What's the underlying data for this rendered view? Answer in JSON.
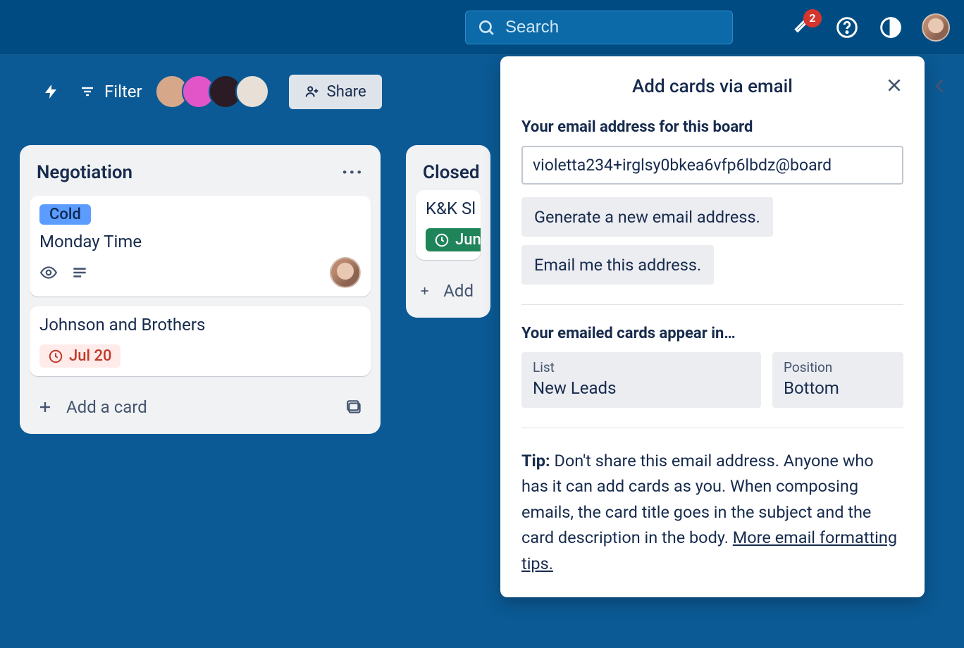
{
  "topbar": {
    "search_placeholder": "Search",
    "notification_count": "2"
  },
  "boardbar": {
    "filter_label": "Filter",
    "share_label": "Share"
  },
  "lists": {
    "negotiation": {
      "title": "Negotiation",
      "add_card": "Add a card",
      "card1": {
        "label": "Cold",
        "title": "Monday Time"
      },
      "card2": {
        "title": "Johnson and Brothers",
        "due": "Jul 20"
      }
    },
    "closed": {
      "title": "Closed",
      "add_card": "Add",
      "card1": {
        "title": "K&K Sl",
        "due": "Jun"
      }
    }
  },
  "modal": {
    "title": "Add cards via email",
    "email_label": "Your email address for this board",
    "email_value": "violetta234+irglsy0bkea6vfp6lbdz@board",
    "btn_generate": "Generate a new email address.",
    "btn_emailme": "Email me this address.",
    "appear_label": "Your emailed cards appear in…",
    "list_label": "List",
    "list_value": "New Leads",
    "position_label": "Position",
    "position_value": "Bottom",
    "tip_prefix": "Tip:",
    "tip_body": " Don't share this email address. Anyone who has it can add cards as you. When composing emails, the card title goes in the subject and the card description in the body. ",
    "tip_link": "More email formatting tips."
  }
}
